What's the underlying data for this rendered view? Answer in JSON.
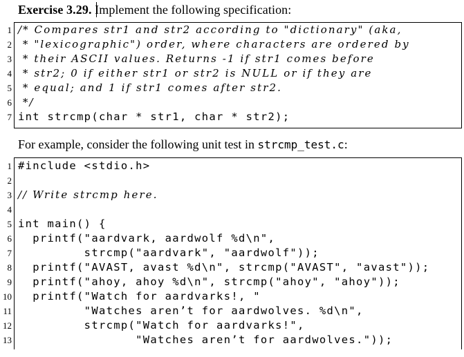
{
  "heading": {
    "bold_label": "Exercise 3.29.",
    "text": "Implement the following specification:"
  },
  "spec_listing": {
    "lines": [
      {
        "number": "1",
        "code": "/* Compares str1 and str2 according to \"dictionary\" (aka,",
        "style": "comment"
      },
      {
        "number": "2",
        "code": " * \"lexicographic\") order, where characters are ordered by",
        "style": "comment"
      },
      {
        "number": "3",
        "code": " * their ASCII values. Returns -1 if str1 comes before",
        "style": "comment"
      },
      {
        "number": "4",
        "code": " * str2; 0 if either str1 or str2 is NULL or if they are",
        "style": "comment"
      },
      {
        "number": "5",
        "code": " * equal; and 1 if str1 comes after str2.",
        "style": "comment"
      },
      {
        "number": "6",
        "code": " */",
        "style": "comment"
      },
      {
        "number": "7",
        "code": "int strcmp(char * str1, char * str2);",
        "style": "code"
      }
    ]
  },
  "paragraph": {
    "text_before": "For example, consider the following unit test in ",
    "filename": "strcmp_test.c",
    "text_after": ":"
  },
  "test_listing": {
    "lines": [
      {
        "number": "1",
        "code": "#include <stdio.h>",
        "style": "code"
      },
      {
        "number": "2",
        "code": "",
        "style": "code"
      },
      {
        "number": "3",
        "code": "// Write strcmp here.",
        "style": "comment"
      },
      {
        "number": "4",
        "code": "",
        "style": "code"
      },
      {
        "number": "5",
        "code": "int main() {",
        "style": "code"
      },
      {
        "number": "6",
        "code": "  printf(\"aardvark, aardwolf %d\\n\",",
        "style": "code"
      },
      {
        "number": "7",
        "code": "         strcmp(\"aardvark\", \"aardwolf\"));",
        "style": "code"
      },
      {
        "number": "8",
        "code": "  printf(\"AVAST, avast %d\\n\", strcmp(\"AVAST\", \"avast\"));",
        "style": "code"
      },
      {
        "number": "9",
        "code": "  printf(\"ahoy, ahoy %d\\n\", strcmp(\"ahoy\", \"ahoy\"));",
        "style": "code"
      },
      {
        "number": "10",
        "code": "  printf(\"Watch for aardvarks!, \"",
        "style": "code"
      },
      {
        "number": "11",
        "code": "         \"Watches aren’t for aardwolves. %d\\n\",",
        "style": "code"
      },
      {
        "number": "12",
        "code": "         strcmp(\"Watch for aardvarks!\",",
        "style": "code"
      },
      {
        "number": "13",
        "code": "                \"Watches aren’t for aardwolves.\"));",
        "style": "code"
      }
    ]
  }
}
